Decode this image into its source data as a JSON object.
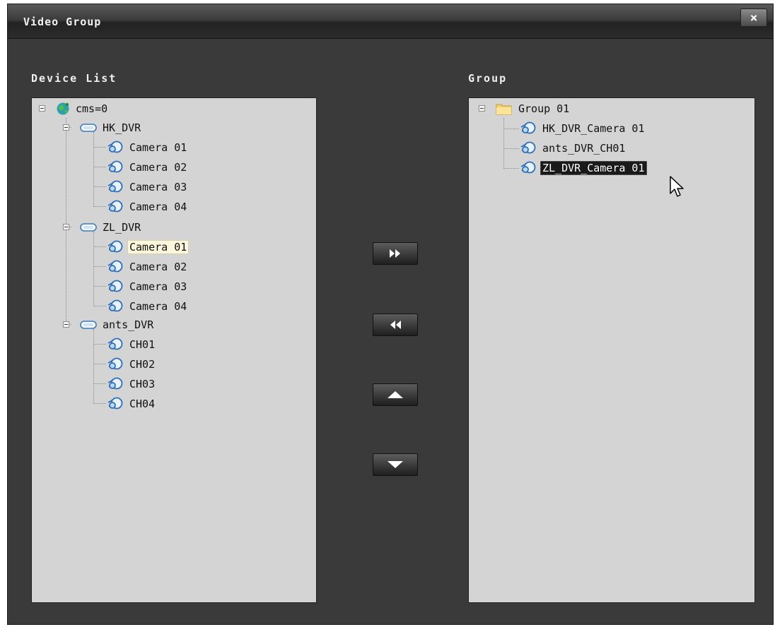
{
  "window": {
    "title": "Video Group",
    "close_label": "×"
  },
  "device_list": {
    "label": "Device List",
    "root": "cms=0",
    "devices": [
      {
        "name": "HK_DVR",
        "channels": [
          "Camera 01",
          "Camera 02",
          "Camera 03",
          "Camera 04"
        ]
      },
      {
        "name": "ZL_DVR",
        "channels": [
          "Camera 01",
          "Camera 02",
          "Camera 03",
          "Camera 04"
        ]
      },
      {
        "name": "ants_DVR",
        "channels": [
          "CH01",
          "CH02",
          "CH03",
          "CH04"
        ]
      }
    ]
  },
  "group": {
    "label": "Group",
    "name": "Group 01",
    "items": [
      "HK_DVR_Camera 01",
      "ants_DVR_CH01",
      "ZL_DVR_Camera 01"
    ]
  },
  "buttons": {
    "add_all_icon": "double-chevron-right-icon",
    "remove_all_icon": "double-chevron-left-icon",
    "move_up_icon": "triangle-up-icon",
    "move_down_icon": "triangle-down-icon"
  },
  "colors": {
    "window_bg": "#3a3a3a",
    "panel_bg": "#d4d4d4",
    "selection_bg": "#1a1a1a",
    "hover_bg": "#fbf6dc"
  }
}
